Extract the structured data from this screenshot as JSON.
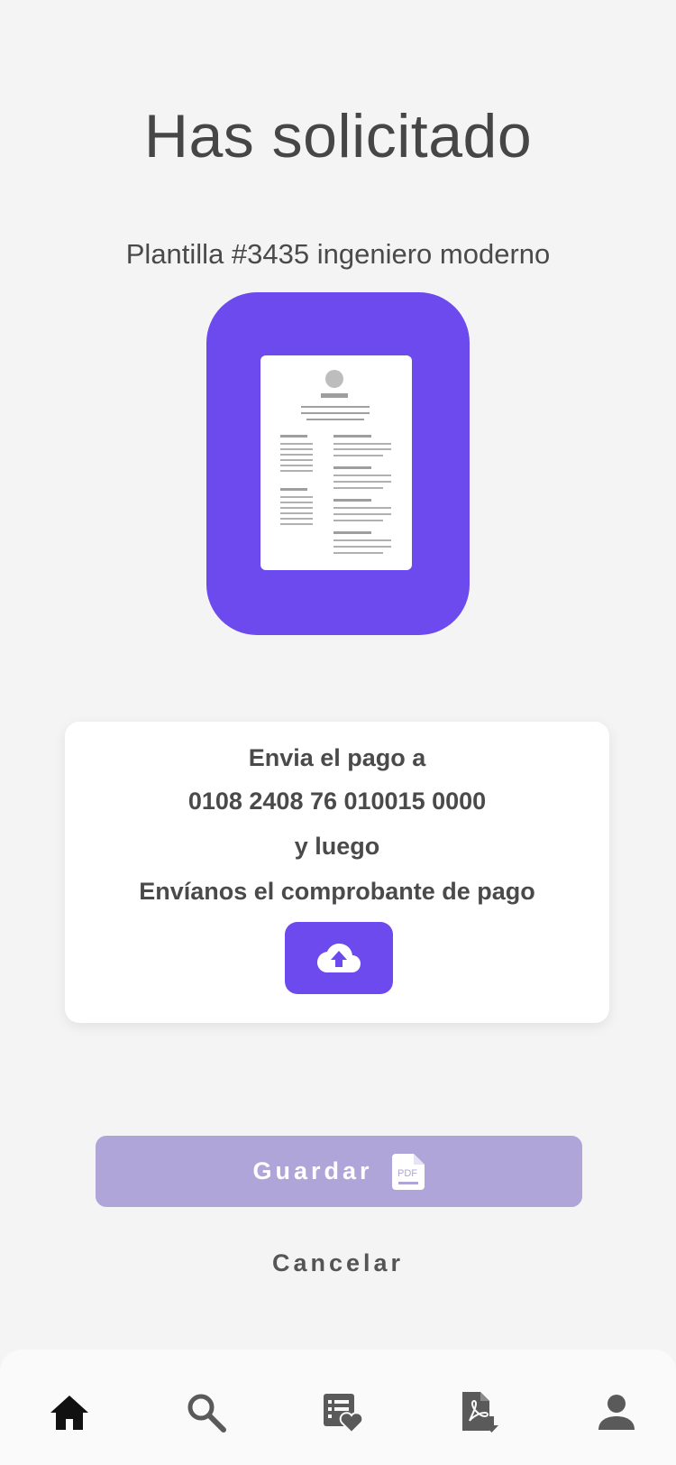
{
  "header": {
    "title": "Has solicitado",
    "template_name": "Plantilla #3435 ingeniero moderno"
  },
  "payment_card": {
    "line1": "Envia el pago a",
    "account_number": "0108 2408 76 010015 0000",
    "line3": "y luego",
    "line4": "Envíanos el comprobante de pago",
    "upload_icon": "cloud-upload-icon"
  },
  "actions": {
    "save_label": "Guardar",
    "save_icon": "pdf-file-icon",
    "save_icon_text": "PDF",
    "cancel_label": "Cancelar"
  },
  "bottom_nav": {
    "items": [
      {
        "icon": "home-icon",
        "active": true
      },
      {
        "icon": "search-icon",
        "active": false
      },
      {
        "icon": "favorite-list-icon",
        "active": false
      },
      {
        "icon": "pdf-download-icon",
        "active": false
      },
      {
        "icon": "person-icon",
        "active": false
      }
    ]
  },
  "colors": {
    "accent": "#6c4aed",
    "save_disabled": "#afa5d8",
    "background": "#f4f4f4",
    "nav_active": "#111111",
    "nav_inactive": "#5a5a5a"
  }
}
